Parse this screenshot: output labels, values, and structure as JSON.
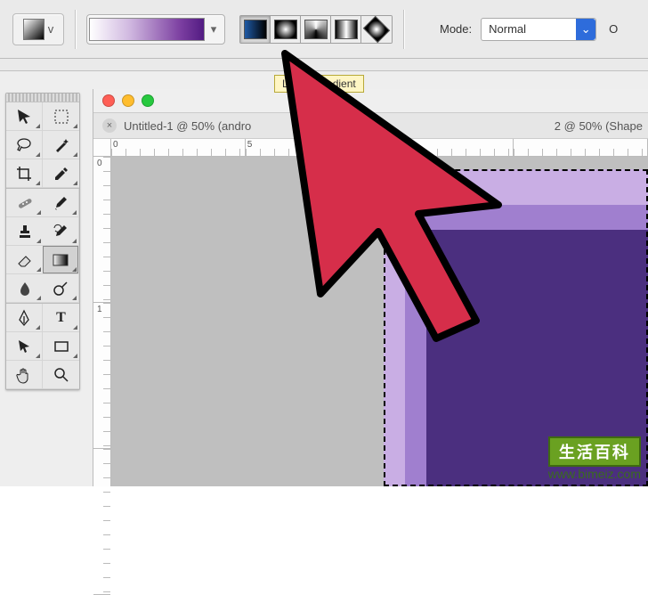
{
  "topbar": {
    "tool_preset_char": "v",
    "gradient_types": [
      "Linear",
      "Radial",
      "Angle",
      "Reflected",
      "Diamond"
    ],
    "mode_label": "Mode:",
    "mode_value": "Normal",
    "trailing_label": "O"
  },
  "tooltip": {
    "text": "Linear Gradient"
  },
  "tabs": {
    "tab1_close": "×",
    "tab1_title": "Untitled-1 @ 50% (andro",
    "tab2_title": "2 @ 50% (Shape"
  },
  "rulers": {
    "h": [
      "0",
      "5"
    ],
    "v": [
      "0",
      "1"
    ]
  },
  "watermark": {
    "title": "生活百科",
    "url": "www.bimeiz.com"
  },
  "tools": [
    {
      "name": "move-tool"
    },
    {
      "name": "artboard-tool"
    },
    {
      "name": "lasso-tool"
    },
    {
      "name": "magic-wand-tool"
    },
    {
      "name": "crop-tool"
    },
    {
      "name": "eyedropper-tool"
    },
    {
      "name": "healing-brush-tool"
    },
    {
      "name": "brush-tool"
    },
    {
      "name": "clone-stamp-tool"
    },
    {
      "name": "history-brush-tool"
    },
    {
      "name": "eraser-tool"
    },
    {
      "name": "gradient-tool",
      "selected": true
    },
    {
      "name": "blur-tool"
    },
    {
      "name": "dodge-tool"
    },
    {
      "name": "pen-tool"
    },
    {
      "name": "type-tool"
    },
    {
      "name": "path-select-tool"
    },
    {
      "name": "rectangle-tool"
    },
    {
      "name": "hand-tool"
    },
    {
      "name": "zoom-tool"
    }
  ]
}
